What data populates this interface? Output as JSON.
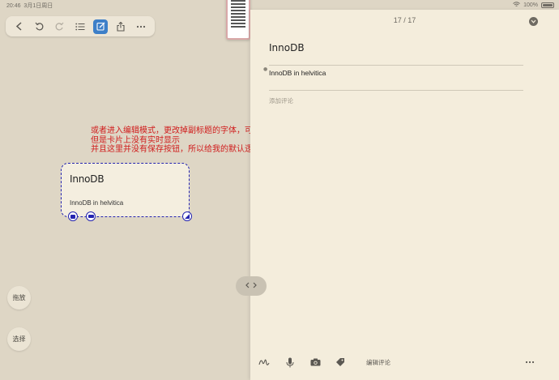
{
  "status_bar": {
    "time": "20:46",
    "date": "3月1日周日",
    "battery": "100%"
  },
  "toolbar": {
    "back": "back-icon",
    "undo": "undo-icon",
    "redo": "redo-icon",
    "list": "list-icon",
    "edit": "edit-icon",
    "share": "share-icon",
    "more": "more-icon"
  },
  "annotation": {
    "line1": "或者进入编辑模式，更改掉副标题的字体，可以看到此事副标题的字体已经是 helvitica 了",
    "line2": "但是卡片上没有实时显示",
    "line3": "并且这里并没有保存按钮，所以给我的默认逻辑就是，关闭即可保存"
  },
  "card": {
    "title": "InnoDB",
    "subtitle": "InnoDB in helvitica"
  },
  "side_buttons": {
    "drag": "拖放",
    "select": "选择"
  },
  "panel": {
    "page_indicator": "17 / 17",
    "title": "InnoDB",
    "subtitle": "InnoDB in helvitica",
    "comment_placeholder": "添加评论",
    "edit_comment": "编辑评论"
  },
  "colors": {
    "background": "#ded6c5",
    "panel": "#f4eddc",
    "annotation": "#d01c1c",
    "selection": "#2424b0",
    "accent": "#3d7fc8"
  }
}
